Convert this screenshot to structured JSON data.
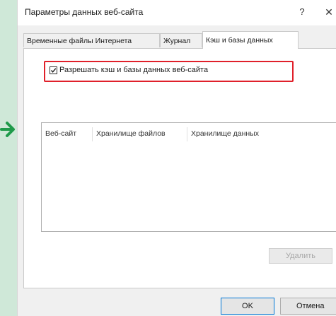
{
  "dialog": {
    "title": "Параметры данных веб-сайта",
    "help_symbol": "?",
    "close_symbol": "✕"
  },
  "tabs": [
    {
      "label": "Временные файлы Интернета",
      "active": false
    },
    {
      "label": "Журнал",
      "active": false
    },
    {
      "label": "Кэш и базы данных",
      "active": true
    }
  ],
  "cache_tab": {
    "allow_checkbox": {
      "label": "Разрешать кэш и базы данных веб-сайта",
      "checked": true
    },
    "table": {
      "columns": [
        "Веб-сайт",
        "Хранилище файлов",
        "Хранилище данных"
      ],
      "rows": []
    },
    "delete_label": "Удалить"
  },
  "footer": {
    "ok_label": "OK",
    "cancel_label": "Отмена"
  },
  "colors": {
    "highlight": "#e0202a",
    "arrow": "#1f9a4a",
    "background": "#cfe8d8",
    "focus": "#0078d7"
  },
  "icons": {
    "arrow": "arrow-right-icon",
    "check": "checkmark-icon"
  }
}
